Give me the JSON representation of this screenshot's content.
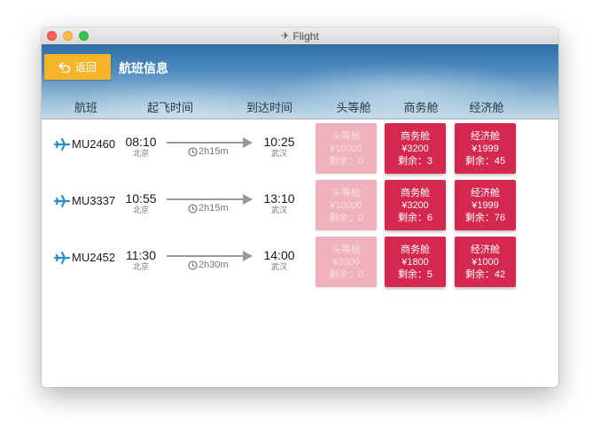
{
  "window": {
    "title": "Flight"
  },
  "header": {
    "back_label": "返回",
    "page_title": "航班信息",
    "columns": {
      "flight": "航班",
      "departure": "起飞时间",
      "arrival": "到达时间",
      "first": "头等舱",
      "business": "商务舱",
      "economy": "经济舱"
    }
  },
  "flights": [
    {
      "flight_no": "MU2460",
      "dep_time": "08:10",
      "dep_city": "北京",
      "arr_time": "10:25",
      "arr_city": "武汉",
      "duration": "2h15m",
      "first": {
        "name": "头等舱",
        "price": "¥10000",
        "remaining": "剩余：0",
        "available": false
      },
      "business": {
        "name": "商务舱",
        "price": "¥3200",
        "remaining": "剩余：3",
        "available": true
      },
      "economy": {
        "name": "经济舱",
        "price": "¥1999",
        "remaining": "剩余：45",
        "available": true
      }
    },
    {
      "flight_no": "MU3337",
      "dep_time": "10:55",
      "dep_city": "北京",
      "arr_time": "13:10",
      "arr_city": "武汉",
      "duration": "2h15m",
      "first": {
        "name": "头等舱",
        "price": "¥10000",
        "remaining": "剩余：0",
        "available": false
      },
      "business": {
        "name": "商务舱",
        "price": "¥3200",
        "remaining": "剩余：6",
        "available": true
      },
      "economy": {
        "name": "经济舱",
        "price": "¥1999",
        "remaining": "剩余：76",
        "available": true
      }
    },
    {
      "flight_no": "MU2452",
      "dep_time": "11:30",
      "dep_city": "北京",
      "arr_time": "14:00",
      "arr_city": "武汉",
      "duration": "2h30m",
      "first": {
        "name": "头等舱",
        "price": "¥3300",
        "remaining": "剩余：0",
        "available": false
      },
      "business": {
        "name": "商务舱",
        "price": "¥1800",
        "remaining": "剩余：5",
        "available": true
      },
      "economy": {
        "name": "经济舱",
        "price": "¥1000",
        "remaining": "剩余：42",
        "available": true
      }
    }
  ],
  "colors": {
    "accent_yellow": "#f6b42a",
    "cabin_red": "#d4284f",
    "cabin_disabled": "#eeb1bd",
    "plane_blue": "#2a8fd0"
  },
  "icons": {
    "back": "back-arrow-icon",
    "plane": "airplane-icon",
    "clock": "clock-icon"
  }
}
